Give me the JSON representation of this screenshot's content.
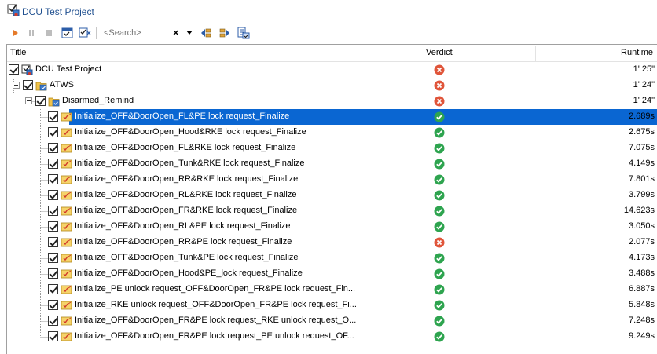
{
  "window": {
    "title": "DCU Test Project"
  },
  "toolbar": {
    "search_placeholder": "<Search>",
    "clear_glyph": "×",
    "buttons": [
      "play-icon",
      "pause-icon",
      "stop-icon",
      "report-icon",
      "checklist-icon",
      "find-previous-icon",
      "find-next-icon",
      "find-all-icon"
    ]
  },
  "columns": {
    "title": "Title",
    "verdict": "Verdict",
    "runtime": "Runtime"
  },
  "colors": {
    "selection": "#0a66d2",
    "pass": "#2ea44f",
    "fail": "#e0553a",
    "title_text": "#1f4f8f"
  },
  "rows": [
    {
      "level": 0,
      "type": "project",
      "title": "DCU Test Project",
      "verdict": "fail",
      "runtime": "1' 25\""
    },
    {
      "level": 1,
      "type": "folder",
      "title": "ATWS",
      "verdict": "fail",
      "runtime": "1' 24\""
    },
    {
      "level": 2,
      "type": "suite",
      "title": "Disarmed_Remind",
      "verdict": "fail",
      "runtime": "1' 24\""
    },
    {
      "level": 3,
      "type": "case",
      "title": "Initialize_OFF&DoorOpen_FL&PE lock request_Finalize",
      "verdict": "pass",
      "runtime": "2.689s",
      "selected": true
    },
    {
      "level": 3,
      "type": "case",
      "title": "Initialize_OFF&DoorOpen_Hood&RKE lock request_Finalize",
      "verdict": "pass",
      "runtime": "2.675s"
    },
    {
      "level": 3,
      "type": "case",
      "title": "Initialize_OFF&DoorOpen_FL&RKE lock request_Finalize",
      "verdict": "pass",
      "runtime": "7.075s"
    },
    {
      "level": 3,
      "type": "case",
      "title": "Initialize_OFF&DoorOpen_Tunk&RKE lock request_Finalize",
      "verdict": "pass",
      "runtime": "4.149s"
    },
    {
      "level": 3,
      "type": "case",
      "title": "Initialize_OFF&DoorOpen_RR&RKE lock request_Finalize",
      "verdict": "pass",
      "runtime": "7.801s"
    },
    {
      "level": 3,
      "type": "case",
      "title": "Initialize_OFF&DoorOpen_RL&RKE lock request_Finalize",
      "verdict": "pass",
      "runtime": "3.799s"
    },
    {
      "level": 3,
      "type": "case",
      "title": "Initialize_OFF&DoorOpen_FR&RKE lock request_Finalize",
      "verdict": "pass",
      "runtime": "14.623s"
    },
    {
      "level": 3,
      "type": "case",
      "title": "Initialize_OFF&DoorOpen_RL&PE lock request_Finalize",
      "verdict": "pass",
      "runtime": "3.050s"
    },
    {
      "level": 3,
      "type": "case",
      "title": "Initialize_OFF&DoorOpen_RR&PE lock request_Finalize",
      "verdict": "fail",
      "runtime": "2.077s"
    },
    {
      "level": 3,
      "type": "case",
      "title": "Initialize_OFF&DoorOpen_Tunk&PE lock request_Finalize",
      "verdict": "pass",
      "runtime": "4.173s"
    },
    {
      "level": 3,
      "type": "case",
      "title": "Initialize_OFF&DoorOpen_Hood&PE_lock request_Finalize",
      "verdict": "pass",
      "runtime": "3.488s"
    },
    {
      "level": 3,
      "type": "case",
      "title": "Initialize_PE unlock request_OFF&DoorOpen_FR&PE lock request_Fin...",
      "verdict": "pass",
      "runtime": "6.887s"
    },
    {
      "level": 3,
      "type": "case",
      "title": "Initialize_RKE unlock request_OFF&DoorOpen_FR&PE lock request_Fi...",
      "verdict": "pass",
      "runtime": "5.848s"
    },
    {
      "level": 3,
      "type": "case",
      "title": "Initialize_OFF&DoorOpen_FR&PE lock request_RKE unlock request_O...",
      "verdict": "pass",
      "runtime": "7.248s"
    },
    {
      "level": 3,
      "type": "case",
      "title": "Initialize_OFF&DoorOpen_FR&PE lock request_PE unlock request_OF...",
      "verdict": "pass",
      "runtime": "9.249s"
    }
  ]
}
